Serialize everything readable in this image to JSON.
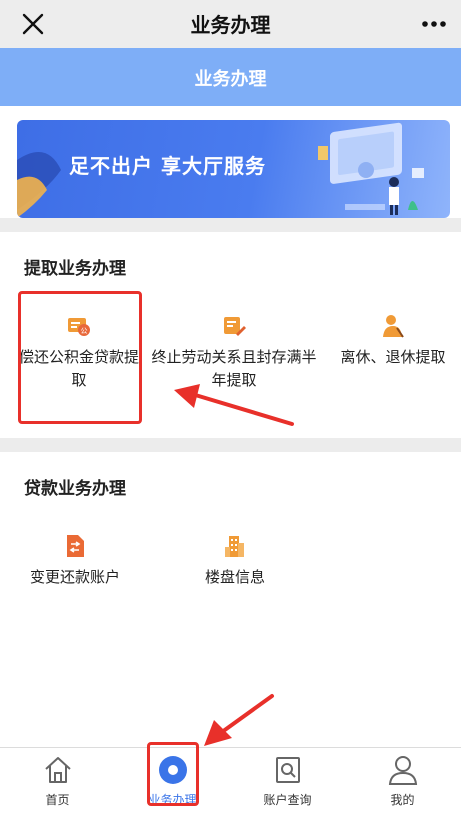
{
  "header": {
    "title": "业务办理"
  },
  "subheader": {
    "title": "业务办理"
  },
  "banner": {
    "text": "足不出户 享大厅服务"
  },
  "section_withdraw": {
    "title": "提取业务办理",
    "items": [
      {
        "label": "偿还公积金贷款提取",
        "icon": "document-official-icon"
      },
      {
        "label": "终止劳动关系且封存满半年提取",
        "icon": "edit-document-icon"
      },
      {
        "label": "离休、退休提取",
        "icon": "retiree-person-icon"
      }
    ]
  },
  "section_loan": {
    "title": "贷款业务办理",
    "items": [
      {
        "label": "变更还款账户",
        "icon": "transfer-file-icon"
      },
      {
        "label": "楼盘信息",
        "icon": "building-icon"
      }
    ]
  },
  "tabbar": {
    "tabs": [
      {
        "label": "首页",
        "icon": "home-icon"
      },
      {
        "label": "业务办理",
        "icon": "business-circle-icon",
        "active": true
      },
      {
        "label": "账户查询",
        "icon": "search-document-icon"
      },
      {
        "label": "我的",
        "icon": "user-icon"
      }
    ]
  },
  "colors": {
    "accent": "#3a74e8",
    "subheader": "#7eaef7",
    "icon_orange": "#f09a36",
    "highlight": "#e8302a"
  }
}
